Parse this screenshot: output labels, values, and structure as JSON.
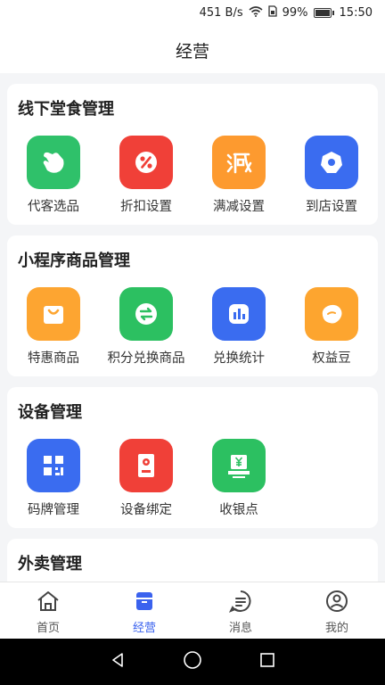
{
  "status_bar": {
    "network_speed": "451 B/s",
    "battery": "99%",
    "time": "15:50"
  },
  "header": {
    "title": "经营"
  },
  "sections": [
    {
      "title": "线下堂食管理",
      "items": [
        {
          "label": "代客选品",
          "icon": "hand-pick-icon",
          "color": "#2fc16a"
        },
        {
          "label": "折扣设置",
          "icon": "percent-icon",
          "color": "#f04038"
        },
        {
          "label": "满减设置",
          "icon": "jian-char-icon",
          "color": "#fd9a2f"
        },
        {
          "label": "到店设置",
          "icon": "store-gear-icon",
          "color": "#3a6cf0"
        }
      ]
    },
    {
      "title": "小程序商品管理",
      "items": [
        {
          "label": "特惠商品",
          "icon": "shopping-bag-icon",
          "color": "#fda531"
        },
        {
          "label": "积分兑换商品",
          "icon": "exchange-icon",
          "color": "#2cc061"
        },
        {
          "label": "兑换统计",
          "icon": "bar-chart-icon",
          "color": "#3a6cf0"
        },
        {
          "label": "权益豆",
          "icon": "bean-icon",
          "color": "#fda52f"
        }
      ]
    },
    {
      "title": "设备管理",
      "items": [
        {
          "label": "码牌管理",
          "icon": "qr-code-icon",
          "color": "#3a6cf0"
        },
        {
          "label": "设备绑定",
          "icon": "device-icon",
          "color": "#f04038"
        },
        {
          "label": "收银点",
          "icon": "cash-register-icon",
          "color": "#2cc061"
        }
      ]
    },
    {
      "title": "外卖管理",
      "items": []
    }
  ],
  "tabs": [
    {
      "label": "首页",
      "icon": "home-icon",
      "active": false
    },
    {
      "label": "经营",
      "icon": "business-icon",
      "active": true
    },
    {
      "label": "消息",
      "icon": "message-icon",
      "active": false
    },
    {
      "label": "我的",
      "icon": "profile-icon",
      "active": false
    }
  ],
  "colors": {
    "accent": "#3a62ee",
    "background": "#f4f5f7"
  }
}
